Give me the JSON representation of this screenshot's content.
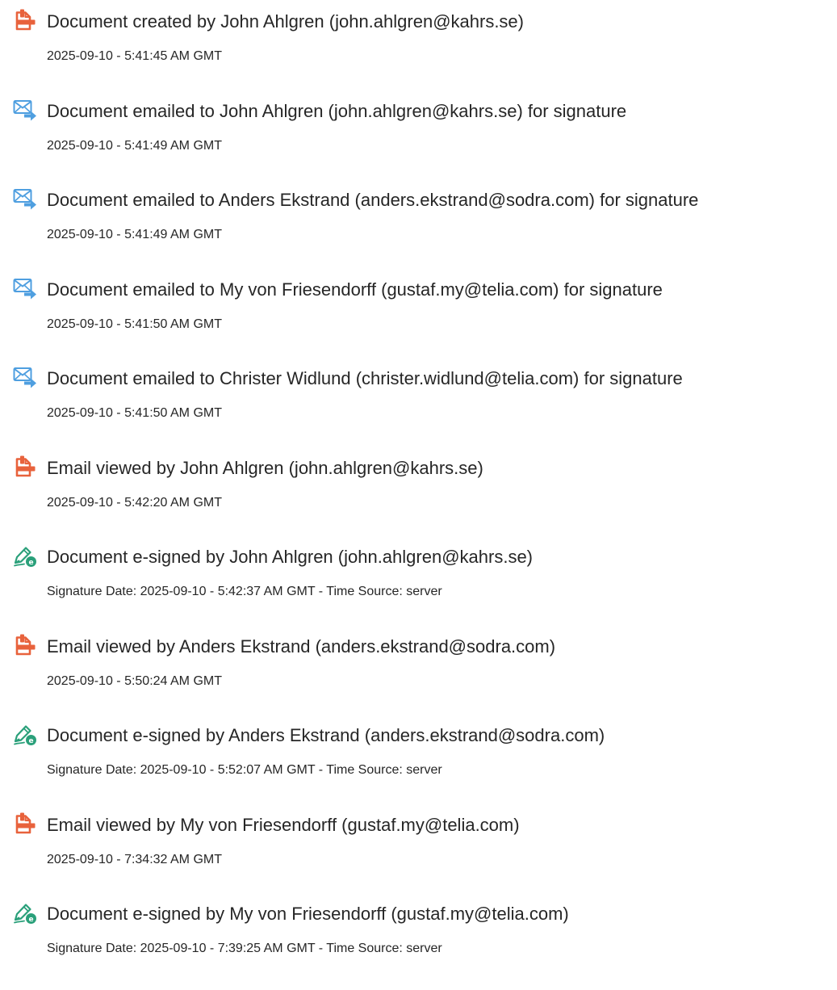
{
  "events": [
    {
      "icon": "document-icon",
      "title": "Document created by John Ahlgren (john.ahlgren@kahrs.se)",
      "date": "2025-09-10 - 5:41:45 AM GMT"
    },
    {
      "icon": "email-sent-icon",
      "title": "Document emailed to John Ahlgren (john.ahlgren@kahrs.se) for signature",
      "date": "2025-09-10 - 5:41:49 AM GMT"
    },
    {
      "icon": "email-sent-icon",
      "title": "Document emailed to Anders Ekstrand (anders.ekstrand@sodra.com) for signature",
      "date": "2025-09-10 - 5:41:49 AM GMT"
    },
    {
      "icon": "email-sent-icon",
      "title": "Document emailed to My von Friesendorff (gustaf.my@telia.com) for signature",
      "date": "2025-09-10 - 5:41:50 AM GMT"
    },
    {
      "icon": "email-sent-icon",
      "title": "Document emailed to Christer Widlund (christer.widlund@telia.com) for signature",
      "date": "2025-09-10 - 5:41:50 AM GMT"
    },
    {
      "icon": "document-icon",
      "title": "Email viewed by John Ahlgren (john.ahlgren@kahrs.se)",
      "date": "2025-09-10 - 5:42:20 AM GMT"
    },
    {
      "icon": "esign-pen-icon",
      "title": "Document e-signed by John Ahlgren (john.ahlgren@kahrs.se)",
      "date": "Signature Date: 2025-09-10 - 5:42:37 AM GMT - Time Source: server"
    },
    {
      "icon": "document-icon",
      "title": "Email viewed by Anders Ekstrand (anders.ekstrand@sodra.com)",
      "date": "2025-09-10 - 5:50:24 AM GMT"
    },
    {
      "icon": "esign-pen-icon",
      "title": "Document e-signed by Anders Ekstrand (anders.ekstrand@sodra.com)",
      "date": "Signature Date: 2025-09-10 - 5:52:07 AM GMT - Time Source: server"
    },
    {
      "icon": "document-icon",
      "title": "Email viewed by My von Friesendorff (gustaf.my@telia.com)",
      "date": "2025-09-10 - 7:34:32 AM GMT"
    },
    {
      "icon": "esign-pen-icon",
      "title": "Document e-signed by My von Friesendorff (gustaf.my@telia.com)",
      "date": "Signature Date: 2025-09-10 - 7:39:25 AM GMT - Time Source: server"
    }
  ],
  "colors": {
    "document_icon": "#e8623c",
    "email_icon": "#4f9fe0",
    "esign_icon": "#2aa07a",
    "text": "#262626"
  }
}
